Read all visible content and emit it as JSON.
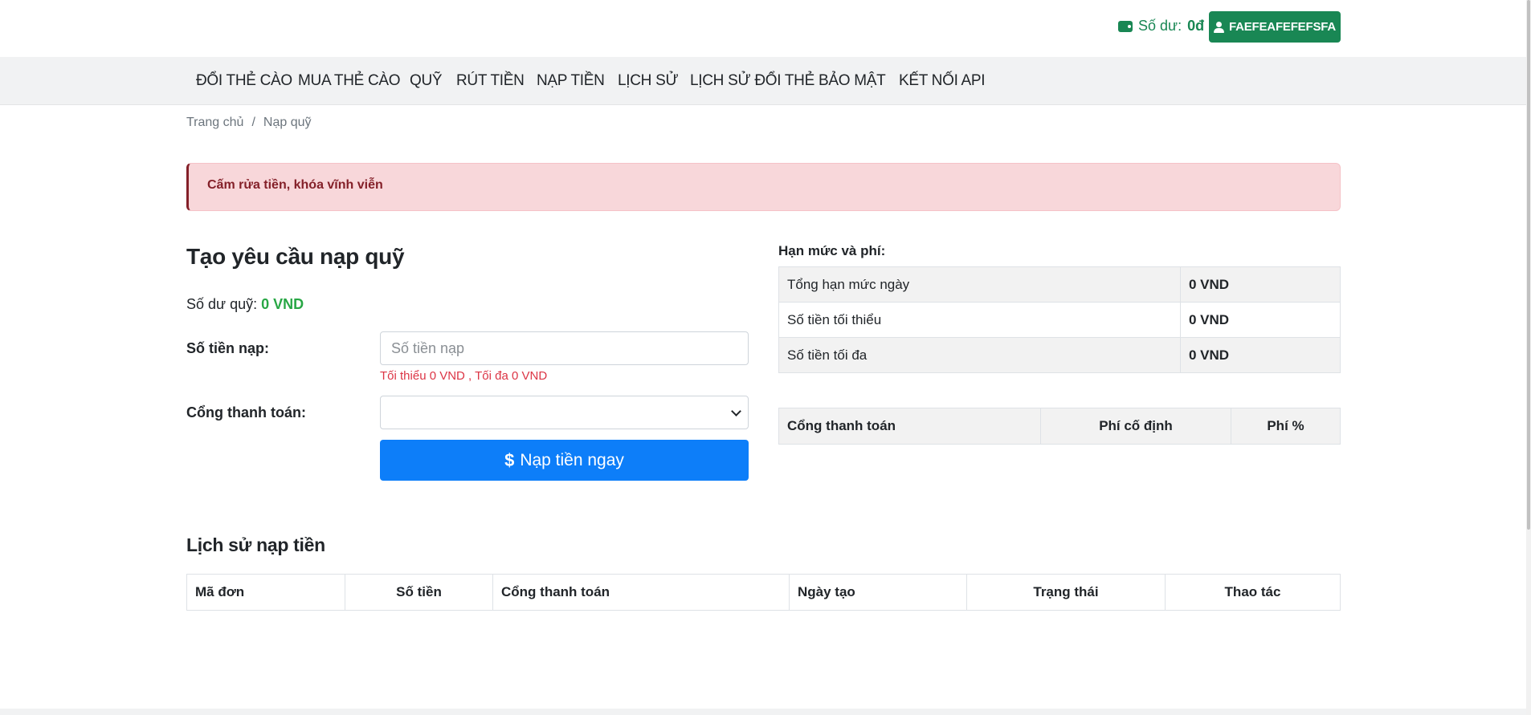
{
  "header": {
    "balance_label": "Số dư:",
    "balance_value": "0đ",
    "username": "FAEFEAFEFEFSFA"
  },
  "nav": {
    "items": [
      {
        "label": "ĐỔI THẺ CÀO"
      },
      {
        "label": "MUA THẺ CÀO"
      },
      {
        "label": "QUỸ"
      },
      {
        "label": "RÚT TIỀN"
      },
      {
        "label": "NẠP TIỀN"
      },
      {
        "label": "LỊCH SỬ"
      },
      {
        "label": "LỊCH SỬ ĐỔI THẺ"
      },
      {
        "label": "BẢO MẬT"
      },
      {
        "label": "KẾT NỐI API"
      }
    ]
  },
  "breadcrumb": {
    "home": "Trang chủ",
    "separator": "/",
    "current": "Nạp quỹ"
  },
  "alert": {
    "text": "Cấm rửa tiền, khóa vĩnh viễn"
  },
  "form": {
    "title": "Tạo yêu cầu nạp quỹ",
    "fund_balance_label": "Số dư quỹ:",
    "fund_balance_value": "0 VND",
    "amount_label": "Số tiền nạp:",
    "amount_placeholder": "Số tiền nạp",
    "amount_hint": "Tối thiểu 0 VND , Tối đa 0 VND",
    "gateway_label": "Cổng thanh toán:",
    "gateway_selected": "",
    "submit_label": "Nạp tiền ngay"
  },
  "limits": {
    "title": "Hạn mức và phí:",
    "rows": [
      {
        "label": "Tổng hạn mức ngày",
        "value": "0 VND"
      },
      {
        "label": "Số tiền tối thiểu",
        "value": "0 VND"
      },
      {
        "label": "Số tiền tối đa",
        "value": "0 VND"
      }
    ]
  },
  "gateway_table": {
    "headers": [
      "Cổng thanh toán",
      "Phí cố định",
      "Phí %"
    ]
  },
  "history": {
    "title": "Lịch sử nạp tiền",
    "headers": [
      "Mã đơn",
      "Số tiền",
      "Cổng thanh toán",
      "Ngày tạo",
      "Trạng thái",
      "Thao tác"
    ]
  },
  "colors": {
    "primary_green": "#198754",
    "accent_blue": "#0d7ef9",
    "alert_bg": "#f8d7da",
    "alert_text": "#842029",
    "hint_red": "#dc3545"
  }
}
